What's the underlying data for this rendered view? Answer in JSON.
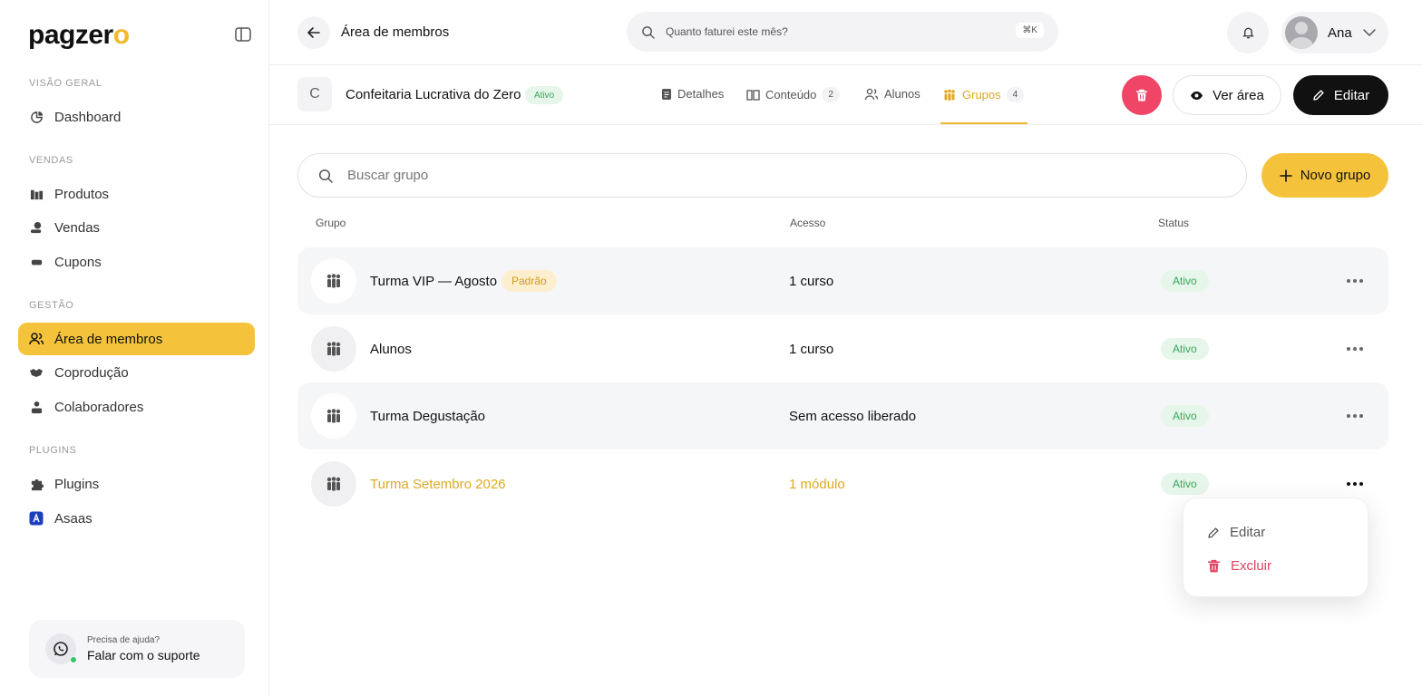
{
  "brand": {
    "logo_prefix": "pagzer",
    "logo_suffix": "o",
    "accent": "#f5c33b"
  },
  "sidebar": {
    "sections": [
      {
        "label": "VISÃO GERAL"
      },
      {
        "label": "VENDAS"
      },
      {
        "label": "GESTÃO"
      },
      {
        "label": "PLUGINS"
      }
    ],
    "items": {
      "dashboard": "Dashboard",
      "produtos": "Produtos",
      "vendas": "Vendas",
      "cupons": "Cupons",
      "area_membros": "Área de membros",
      "coproducao": "Coprodução",
      "colaboradores": "Colaboradores",
      "plugins": "Plugins",
      "asaas": "Asaas"
    },
    "help": {
      "title": "Precisa de ajuda?",
      "action": "Falar com o suporte"
    }
  },
  "topbar": {
    "title": "Área de membros",
    "search_placeholder": "Quanto faturei este mês?",
    "search_shortcut": "⌘K",
    "user_name": "Ana"
  },
  "product": {
    "initial": "C",
    "name": "Confeitaria Lucrativa do Zero",
    "status": "Ativo",
    "tabs": {
      "detalhes": {
        "label": "Detalhes"
      },
      "conteudo": {
        "label": "Conteúdo",
        "count": "2"
      },
      "alunos": {
        "label": "Alunos"
      },
      "grupos": {
        "label": "Grupos",
        "count": "4"
      }
    },
    "view_label": "Ver área",
    "edit_label": "Editar"
  },
  "groups": {
    "search_placeholder": "Buscar grupo",
    "new_label": "Novo grupo",
    "columns": {
      "grupo": "Grupo",
      "acesso": "Acesso",
      "status": "Status"
    },
    "rows": [
      {
        "name": "Turma VIP — Agosto",
        "badge": "Padrão",
        "access": "1 curso",
        "status": "Ativo"
      },
      {
        "name": "Alunos",
        "access": "1 curso",
        "status": "Ativo"
      },
      {
        "name": "Turma Degustação",
        "access": "Sem acesso liberado",
        "status": "Ativo"
      },
      {
        "name": "Turma Setembro 2026",
        "access": "1 módulo",
        "status": "Ativo"
      }
    ]
  },
  "row_menu": {
    "edit": "Editar",
    "delete": "Excluir"
  }
}
